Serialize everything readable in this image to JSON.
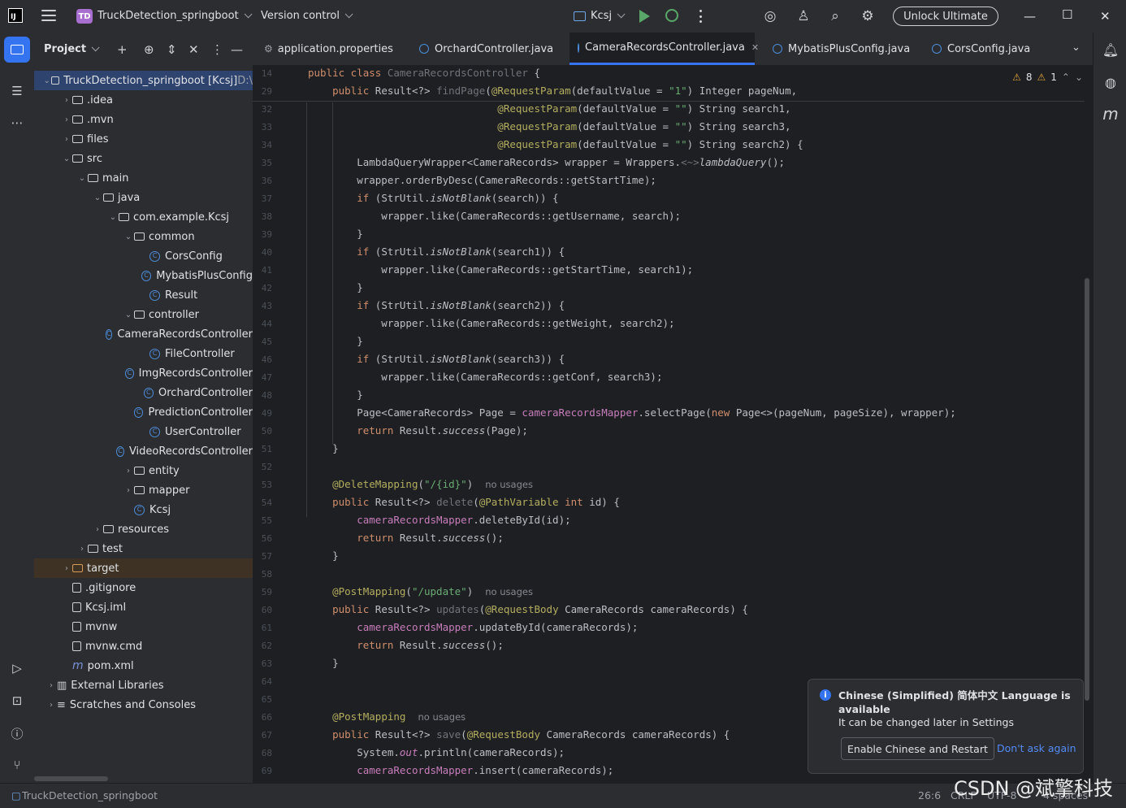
{
  "titlebar": {
    "logo": "IJ",
    "project_badge": "TD",
    "project_name": "TruckDetection_springboot",
    "vcs_label": "Version control",
    "run_config": "Kcsj",
    "unlock_label": "Unlock Ultimate",
    "icons": [
      "hamburger-icon",
      "play-icon",
      "debug-icon",
      "more-icon",
      "ai-assistant-icon",
      "add-user-icon",
      "search-icon",
      "settings-icon",
      "minimize-icon",
      "maximize-icon",
      "close-icon"
    ]
  },
  "project_panel": {
    "title": "Project",
    "tree": [
      {
        "label": "TruckDetection_springboot [Kcsj]",
        "suffix": "D:\\",
        "depth": 0,
        "arrow": "open",
        "icon": "folder"
      },
      {
        "label": ".idea",
        "depth": 1,
        "arrow": "closed",
        "icon": "folder"
      },
      {
        "label": ".mvn",
        "depth": 1,
        "arrow": "closed",
        "icon": "folder"
      },
      {
        "label": "files",
        "depth": 1,
        "arrow": "closed",
        "icon": "folder"
      },
      {
        "label": "src",
        "depth": 1,
        "arrow": "open",
        "icon": "folder"
      },
      {
        "label": "main",
        "depth": 2,
        "arrow": "open",
        "icon": "folder"
      },
      {
        "label": "java",
        "depth": 3,
        "arrow": "open",
        "icon": "folder"
      },
      {
        "label": "com.example.Kcsj",
        "depth": 4,
        "arrow": "open",
        "icon": "package"
      },
      {
        "label": "common",
        "depth": 5,
        "arrow": "open",
        "icon": "package"
      },
      {
        "label": "CorsConfig",
        "depth": 6,
        "arrow": "",
        "icon": "class"
      },
      {
        "label": "MybatisPlusConfig",
        "depth": 6,
        "arrow": "",
        "icon": "class"
      },
      {
        "label": "Result",
        "depth": 6,
        "arrow": "",
        "icon": "class"
      },
      {
        "label": "controller",
        "depth": 5,
        "arrow": "open",
        "icon": "package"
      },
      {
        "label": "CameraRecordsController",
        "depth": 6,
        "arrow": "",
        "icon": "class"
      },
      {
        "label": "FileController",
        "depth": 6,
        "arrow": "",
        "icon": "class"
      },
      {
        "label": "ImgRecordsController",
        "depth": 6,
        "arrow": "",
        "icon": "class"
      },
      {
        "label": "OrchardController",
        "depth": 6,
        "arrow": "",
        "icon": "class"
      },
      {
        "label": "PredictionController",
        "depth": 6,
        "arrow": "",
        "icon": "class"
      },
      {
        "label": "UserController",
        "depth": 6,
        "arrow": "",
        "icon": "class"
      },
      {
        "label": "VideoRecordsController",
        "depth": 6,
        "arrow": "",
        "icon": "class"
      },
      {
        "label": "entity",
        "depth": 5,
        "arrow": "closed",
        "icon": "package"
      },
      {
        "label": "mapper",
        "depth": 5,
        "arrow": "closed",
        "icon": "package"
      },
      {
        "label": "Kcsj",
        "depth": 5,
        "arrow": "",
        "icon": "class"
      },
      {
        "label": "resources",
        "depth": 3,
        "arrow": "closed",
        "icon": "folder"
      },
      {
        "label": "test",
        "depth": 2,
        "arrow": "closed",
        "icon": "folder"
      },
      {
        "label": "target",
        "depth": 1,
        "arrow": "closed",
        "icon": "folder-orange"
      },
      {
        "label": ".gitignore",
        "depth": 1,
        "arrow": "",
        "icon": "file"
      },
      {
        "label": "Kcsj.iml",
        "depth": 1,
        "arrow": "",
        "icon": "file"
      },
      {
        "label": "mvnw",
        "depth": 1,
        "arrow": "",
        "icon": "file"
      },
      {
        "label": "mvnw.cmd",
        "depth": 1,
        "arrow": "",
        "icon": "file"
      },
      {
        "label": "pom.xml",
        "depth": 1,
        "arrow": "",
        "icon": "maven"
      },
      {
        "label": "External Libraries",
        "depth": 0,
        "arrow": "closed",
        "icon": "library"
      },
      {
        "label": "Scratches and Consoles",
        "depth": 0,
        "arrow": "closed",
        "icon": "scratch"
      }
    ]
  },
  "tabs": [
    {
      "label": "application.properties",
      "icon": "settings"
    },
    {
      "label": "OrchardController.java",
      "icon": "class"
    },
    {
      "label": "CameraRecordsController.java",
      "icon": "class",
      "active": true
    },
    {
      "label": "MybatisPlusConfig.java",
      "icon": "class"
    },
    {
      "label": "CorsConfig.java",
      "icon": "class"
    }
  ],
  "inspections": {
    "warnings": "8",
    "weak_warnings": "1"
  },
  "sticky_lines": [
    {
      "n": "14",
      "html": "<span class=\"kw\">public class </span><span class=\"dim\">CameraRecordsController</span> {"
    },
    {
      "n": "29",
      "html": "    <span class=\"kw\">public </span>Result&lt;?&gt; <span class=\"dim\">findPage</span>(<span class=\"an\">@RequestParam</span>(defaultValue = <span class=\"st\">\"1\"</span>) Integer pageNum,"
    }
  ],
  "code_lines": [
    {
      "n": "32",
      "html": "                               <span class=\"an\">@RequestParam</span>(defaultValue = <span class=\"st\">\"\"</span>) String search1,"
    },
    {
      "n": "33",
      "html": "                               <span class=\"an\">@RequestParam</span>(defaultValue = <span class=\"st\">\"\"</span>) String search3,"
    },
    {
      "n": "34",
      "html": "                               <span class=\"an\">@RequestParam</span>(defaultValue = <span class=\"st\">\"\"</span>) String search2) {"
    },
    {
      "n": "35",
      "html": "        LambdaQueryWrapper&lt;CameraRecords&gt; wrapper = Wrappers.<span class=\"dim\">&lt;~&gt;</span><span class=\"it\">lambdaQuery</span>();"
    },
    {
      "n": "36",
      "html": "        wrapper.orderByDesc(CameraRecords::getStartTime);"
    },
    {
      "n": "37",
      "html": "        <span class=\"kw\">if </span>(StrUtil.<span class=\"it\">isNotBlank</span>(search)) {"
    },
    {
      "n": "38",
      "html": "            wrapper.like(CameraRecords::getUsername, search);"
    },
    {
      "n": "39",
      "html": "        }"
    },
    {
      "n": "40",
      "html": "        <span class=\"kw\">if </span>(StrUtil.<span class=\"it\">isNotBlank</span>(search1)) {"
    },
    {
      "n": "41",
      "html": "            wrapper.like(CameraRecords::getStartTime, search1);"
    },
    {
      "n": "42",
      "html": "        }"
    },
    {
      "n": "43",
      "html": "        <span class=\"kw\">if </span>(StrUtil.<span class=\"it\">isNotBlank</span>(search2)) {"
    },
    {
      "n": "44",
      "html": "            wrapper.like(CameraRecords::getWeight, search2);"
    },
    {
      "n": "45",
      "html": "        }"
    },
    {
      "n": "46",
      "html": "        <span class=\"kw\">if </span>(StrUtil.<span class=\"it\">isNotBlank</span>(search3)) {"
    },
    {
      "n": "47",
      "html": "            wrapper.like(CameraRecords::getConf, search3);"
    },
    {
      "n": "48",
      "html": "        }"
    },
    {
      "n": "49",
      "html": "        Page&lt;CameraRecords&gt; Page = <span class=\"fld\">cameraRecordsMapper</span>.selectPage(<span class=\"kw\">new </span>Page&lt;&gt;(pageNum, pageSize), wrapper);"
    },
    {
      "n": "50",
      "html": "        <span class=\"kw\">return </span>Result.<span class=\"it\">success</span>(Page);"
    },
    {
      "n": "51",
      "html": "    }"
    },
    {
      "n": "52",
      "html": ""
    },
    {
      "n": "53",
      "html": "    <span class=\"an\">@DeleteMapping</span>(<span class=\"st\">\"/{id}\"</span>)  <span class=\"hint\">no usages</span>"
    },
    {
      "n": "54",
      "html": "    <span class=\"kw\">public </span>Result&lt;?&gt; <span class=\"dim\">delete</span>(<span class=\"an\">@PathVariable </span><span class=\"kw\">int </span>id) {"
    },
    {
      "n": "55",
      "html": "        <span class=\"fld\">cameraRecordsMapper</span>.deleteById(id);"
    },
    {
      "n": "56",
      "html": "        <span class=\"kw\">return </span>Result.<span class=\"it\">success</span>();"
    },
    {
      "n": "57",
      "html": "    }"
    },
    {
      "n": "58",
      "html": ""
    },
    {
      "n": "59",
      "html": "    <span class=\"an\">@PostMapping</span>(<span class=\"st\">\"/update\"</span>)  <span class=\"hint\">no usages</span>"
    },
    {
      "n": "60",
      "html": "    <span class=\"kw\">public </span>Result&lt;?&gt; <span class=\"dim\">updates</span>(<span class=\"an\">@RequestBody </span>CameraRecords cameraRecords) {"
    },
    {
      "n": "61",
      "html": "        <span class=\"fld\">cameraRecordsMapper</span>.updateById(cameraRecords);"
    },
    {
      "n": "62",
      "html": "        <span class=\"kw\">return </span>Result.<span class=\"it\">success</span>();"
    },
    {
      "n": "63",
      "html": "    }"
    },
    {
      "n": "64",
      "html": ""
    },
    {
      "n": "65",
      "html": ""
    },
    {
      "n": "66",
      "html": "    <span class=\"an\">@PostMapping</span>  <span class=\"hint\">no usages</span>"
    },
    {
      "n": "67",
      "html": "    <span class=\"kw\">public </span>Result&lt;?&gt; <span class=\"dim\">save</span>(<span class=\"an\">@RequestBody </span>CameraRecords cameraRecords) {"
    },
    {
      "n": "68",
      "html": "        System.<span class=\"fld it\">out</span>.println(cameraRecords);"
    },
    {
      "n": "69",
      "html": "        <span class=\"fld\">cameraRecordsMapper</span>.insert(cameraRecords);"
    }
  ],
  "notification": {
    "title": "Chinese (Simplified) 简体中文 Language is available",
    "body": "It can be changed later in Settings",
    "primary_action": "Enable Chinese and Restart",
    "secondary_action": "Don't ask again"
  },
  "statusbar": {
    "breadcrumb": "TruckDetection_springboot",
    "position": "26:6",
    "line_sep": "CRLF",
    "encoding": "UTF-8",
    "indent": "4 spaces"
  },
  "watermark": "CSDN @斌擎科技",
  "colors": {
    "accent": "#3574f0",
    "keyword": "#cf8e6d",
    "annotation": "#b3ae60",
    "string": "#6aab73",
    "field": "#c77dbb"
  }
}
